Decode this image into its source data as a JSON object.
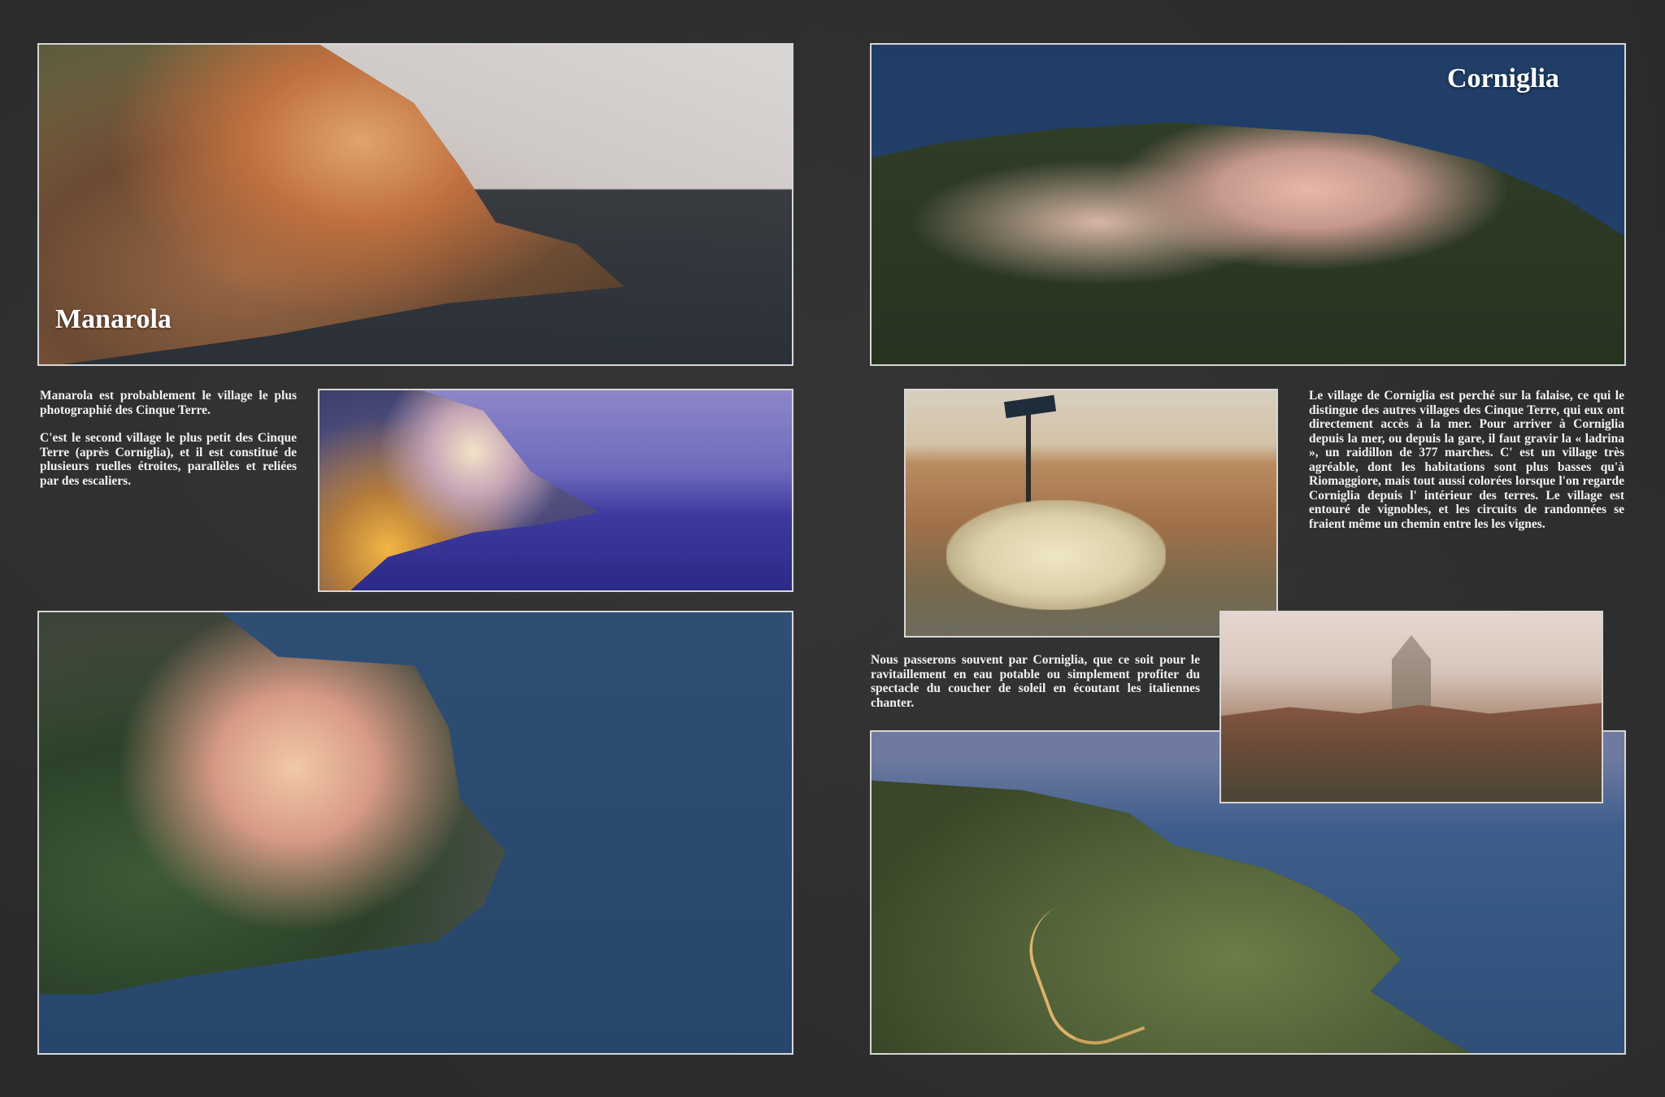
{
  "left_page": {
    "caption": "Manarola",
    "paragraphs": [
      "Manarola est probablement le village le plus photographié des Cinque Terre.",
      "C'est le second village le plus petit des Cinque Terre (après Corniglia), et il est constitué de plusieurs ruelles étroites, parallèles et reliées par des escaliers."
    ]
  },
  "right_page": {
    "caption": "Corniglia",
    "paragraph_main": "Le village de Corniglia est perché sur la falaise, ce qui le distingue des autres villages des Cinque Terre, qui eux ont directement accès à la mer. Pour arriver à Corniglia depuis la mer, ou depuis la gare, il faut gravir la « ladrina », un raidillon de 377 marches. C' est un village très agréable, dont les habitations sont plus basses qu'à Riomaggiore, mais tout aussi colorées lorsque l'on regarde Corniglia depuis l' intérieur des terres. Le village est entouré de vignobles, et les circuits de randonnées se fraient même un chemin entre les les vignes.",
    "paragraph_secondary": "Nous passerons souvent par Corniglia, que ce soit pour le ravitaillement en eau potable ou simplement profiter du spectacle du coucher de soleil en écoutant les italiennes chanter."
  }
}
